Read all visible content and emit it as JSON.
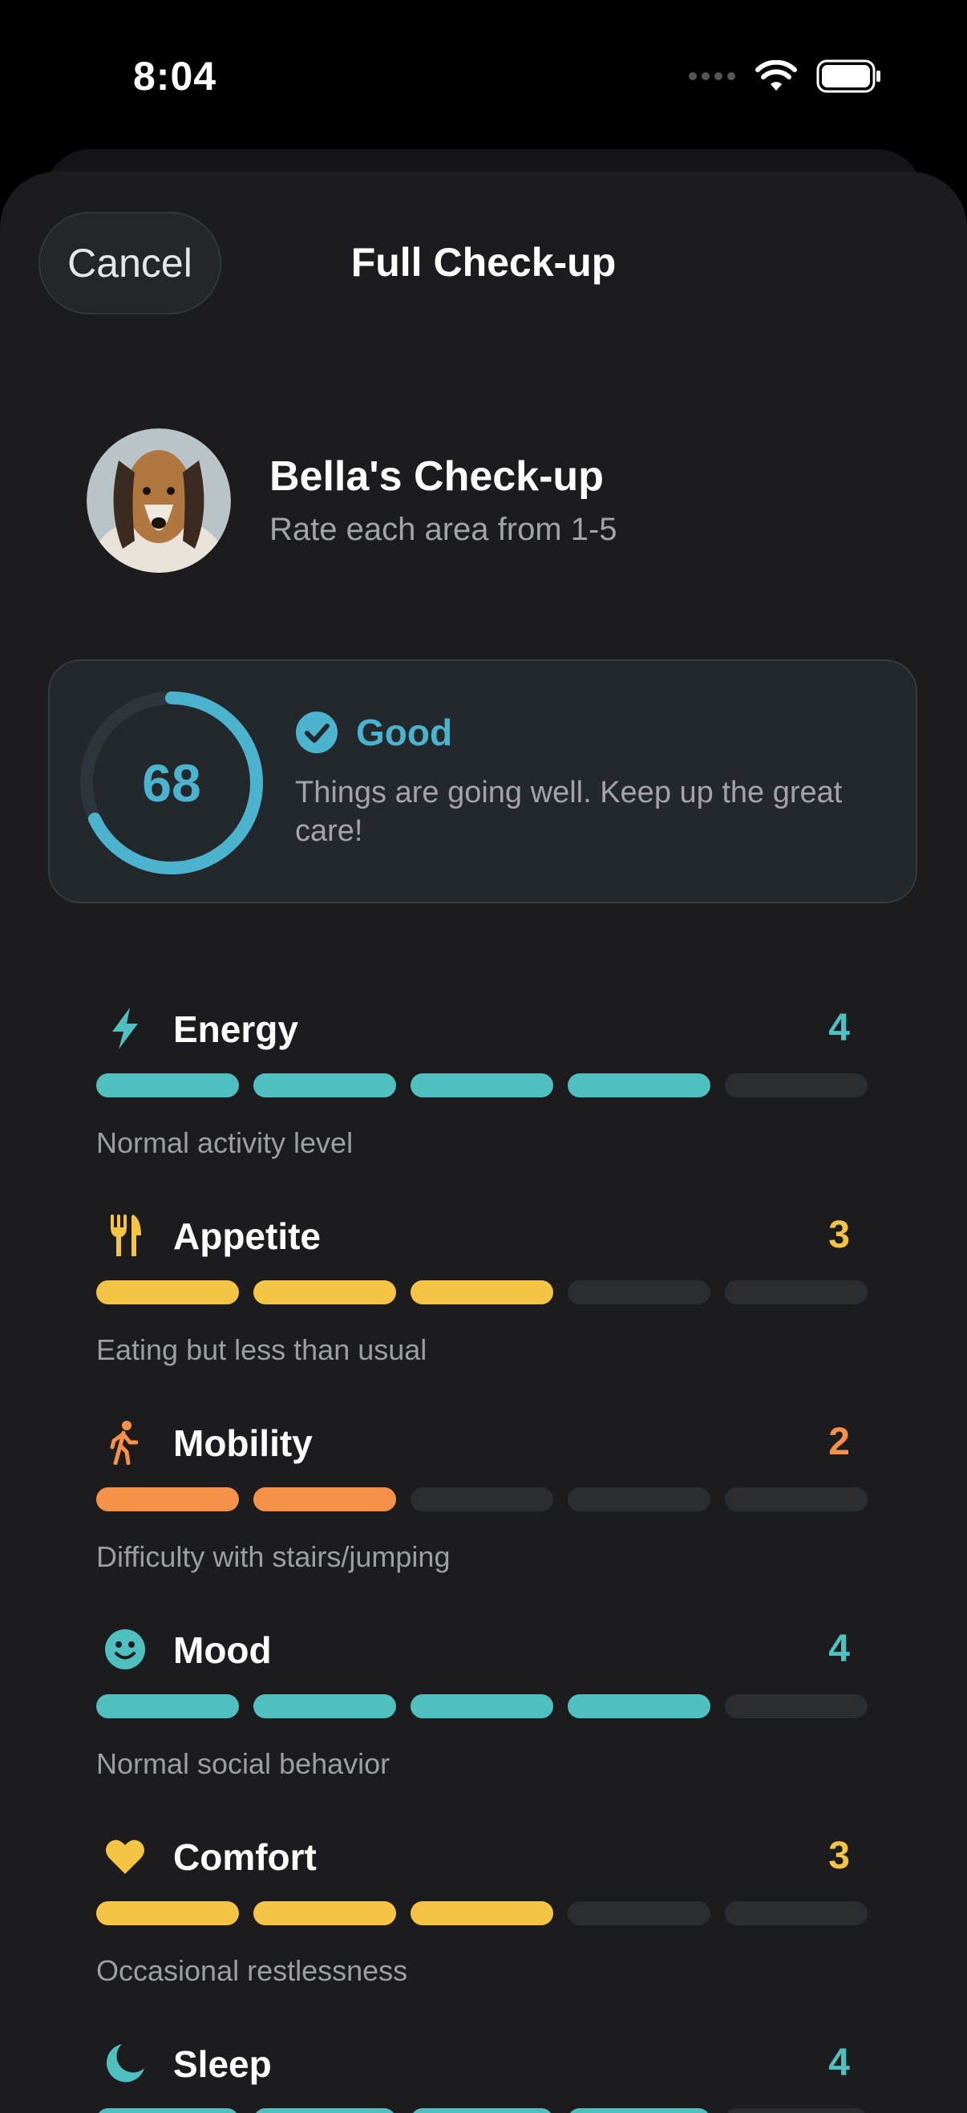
{
  "status_bar": {
    "time": "8:04"
  },
  "header": {
    "cancel_label": "Cancel",
    "title": "Full Check-up"
  },
  "profile": {
    "name": "Bella's Check-up",
    "subtitle": "Rate each area from 1-5"
  },
  "score": {
    "value": "68",
    "fraction": 0.68,
    "status": "Good",
    "description": "Things are going well. Keep up the great care!",
    "color": "#4cb3cf"
  },
  "metrics": [
    {
      "name": "Energy",
      "value": "4",
      "rating": 4,
      "max": 5,
      "description": "Normal activity level",
      "color": "#4fbfbf",
      "icon": "lightning-icon"
    },
    {
      "name": "Appetite",
      "value": "3",
      "rating": 3,
      "max": 5,
      "description": "Eating but less than usual",
      "color": "#f6c445",
      "icon": "fork-knife-icon"
    },
    {
      "name": "Mobility",
      "value": "2",
      "rating": 2,
      "max": 5,
      "description": "Difficulty with stairs/jumping",
      "color": "#f7914a",
      "icon": "walking-person-icon"
    },
    {
      "name": "Mood",
      "value": "4",
      "rating": 4,
      "max": 5,
      "description": "Normal social behavior",
      "color": "#4fbfbf",
      "icon": "smiley-face-icon"
    },
    {
      "name": "Comfort",
      "value": "3",
      "rating": 3,
      "max": 5,
      "description": "Occasional restlessness",
      "color": "#f6c445",
      "icon": "heart-icon"
    },
    {
      "name": "Sleep",
      "value": "4",
      "rating": 4,
      "max": 5,
      "description": "",
      "color": "#4fbfbf",
      "icon": "moon-icon"
    }
  ]
}
